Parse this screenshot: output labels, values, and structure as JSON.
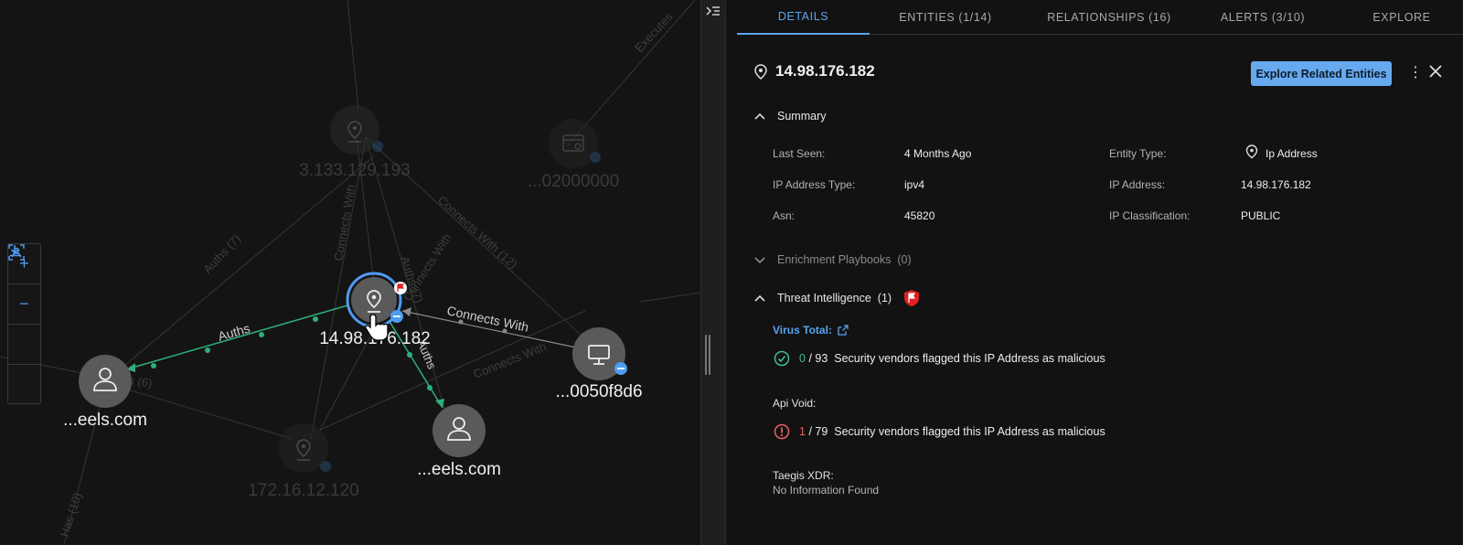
{
  "graph": {
    "nodes": {
      "center": {
        "label": "14.98.176.182",
        "icon": "location-pin-icon"
      },
      "left_user": {
        "label": "...eels.com",
        "icon": "user-icon"
      },
      "bottom_user": {
        "label": "...eels.com",
        "icon": "user-icon"
      },
      "host": {
        "label": "...0050f8d6",
        "icon": "monitor-icon"
      },
      "faded_ip_top": {
        "label": "3.133.129.193",
        "icon": "location-pin-icon"
      },
      "faded_process": {
        "label": "...02000000",
        "icon": "process-icon"
      },
      "faded_ip_bottom": {
        "label": "172.16.12.120",
        "icon": "location-pin-icon"
      }
    },
    "edges": {
      "auths": "Auths",
      "auths_down": "Auths",
      "connects_with": "Connects With",
      "faded_auths_7": "Auths (7)",
      "faded_connects_with": "Connects With",
      "faded_connects_12": "Connects With (12)",
      "faded_executes": "Executes",
      "faded_auths_top": "Auths (7)",
      "faded_connects_mid": "Connects With",
      "faded_connects_right": "Connects With",
      "faded_has": "Has (10)",
      "faded_s6": "s (6)"
    },
    "zoom_controls": [
      "+",
      "−",
      "fit-view-icon",
      "download-icon"
    ]
  },
  "tabs": [
    {
      "label": "DETAILS",
      "active": true
    },
    {
      "label": "ENTITIES (1/14)",
      "active": false
    },
    {
      "label": "RELATIONSHIPS (16)",
      "active": false
    },
    {
      "label": "ALERTS (3/10)",
      "active": false
    },
    {
      "label": "EXPLORE",
      "active": false
    }
  ],
  "header": {
    "title": "14.98.176.182",
    "explore_button": "Explore Related Entities"
  },
  "summary": {
    "title": "Summary",
    "fields": {
      "last_seen_label": "Last Seen:",
      "last_seen": "4 Months Ago",
      "ip_type_label": "IP Address Type:",
      "ip_type": "ipv4",
      "asn_label": "Asn:",
      "asn": "45820",
      "entity_type_label": "Entity Type:",
      "entity_type": "Ip Address",
      "ip_label": "IP Address:",
      "ip": "14.98.176.182",
      "classification_label": "IP Classification:",
      "classification": "PUBLIC"
    }
  },
  "enrichment": {
    "title": "Enrichment Playbooks",
    "count": "(0)"
  },
  "threat_intel": {
    "title": "Threat Intelligence",
    "count": "(1)",
    "virus_total": {
      "label": "Virus Total:",
      "flagged": "0",
      "total": "/ 93",
      "text": "Security vendors flagged this IP Address as malicious"
    },
    "api_void": {
      "label": "Api Void:",
      "flagged": "1",
      "total": "/ 79",
      "text": "Security vendors flagged this IP Address as malicious"
    },
    "taegis": {
      "label": "Taegis XDR:",
      "text": "No Information Found"
    }
  },
  "colors": {
    "accent": "#5aa3f2",
    "button": "#66a9ef",
    "ok": "#3fbf8a",
    "bad": "#f06060",
    "edge_green": "#2fae7a",
    "flag_red": "#e02020"
  }
}
